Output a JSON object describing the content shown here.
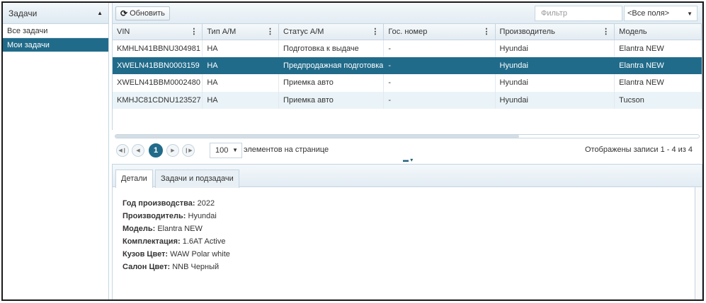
{
  "sidebar": {
    "header": "Задачи",
    "items": [
      {
        "label": "Все задачи"
      },
      {
        "label": "Мои задачи"
      }
    ]
  },
  "toolbar": {
    "refresh_label": "Обновить",
    "filter_placeholder": "Фильтр",
    "fields_select": "<Все поля>"
  },
  "grid": {
    "columns": [
      "VIN",
      "Тип А/М",
      "Статус А/М",
      "Гос. номер",
      "Производитель",
      "Модель"
    ],
    "rows": [
      [
        "KMHLN41BBNU304981",
        "HA",
        "Подготовка к выдаче",
        "-",
        "Hyundai",
        "Elantra NEW"
      ],
      [
        "XWELN41BBN0003159",
        "HA",
        "Предпродажная подготовка",
        "-",
        "Hyundai",
        "Elantra NEW"
      ],
      [
        "XWELN41BBM0002480",
        "HA",
        "Приемка авто",
        "-",
        "Hyundai",
        "Elantra NEW"
      ],
      [
        "KMHJC81CDNU123527",
        "HA",
        "Приемка авто",
        "-",
        "Hyundai",
        "Tucson"
      ]
    ],
    "selected_row": 1
  },
  "pager": {
    "current_page": "1",
    "page_size": "100",
    "page_size_label": "элементов на странице",
    "records_info": "Отображены записи 1 - 4 из 4"
  },
  "detail": {
    "tabs": [
      {
        "label": "Детали"
      },
      {
        "label": "Задачи и подзадачи"
      }
    ],
    "fields": [
      {
        "label": "Год производства:",
        "value": "2022"
      },
      {
        "label": "Производитель:",
        "value": "Hyundai"
      },
      {
        "label": "Модель:",
        "value": "Elantra NEW"
      },
      {
        "label": "Комплектация:",
        "value": "1.6AT Active"
      },
      {
        "label": "Кузов Цвет:",
        "value": "WAW Polar white"
      },
      {
        "label": "Салон Цвет:",
        "value": "NNB Черный"
      }
    ]
  },
  "colors": {
    "accent": "#216b8a",
    "row_alt": "#eaf3f8"
  }
}
